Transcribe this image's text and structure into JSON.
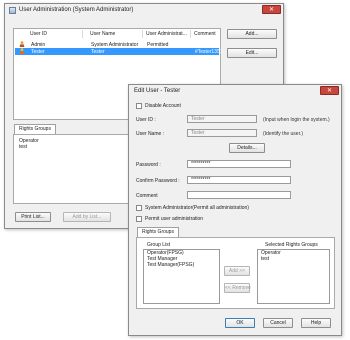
{
  "main_window": {
    "title": "User Administration (System Administrator)",
    "close_glyph": "✕",
    "columns": [
      "User ID",
      "User Name",
      "User Administrat...",
      "Comment"
    ],
    "users": [
      {
        "id": "Admin",
        "name": "System Administrator",
        "admin": "Permitted",
        "comment": ""
      },
      {
        "id": "Tester",
        "name": "Tester",
        "admin": "",
        "comment": "#Tester1351"
      }
    ],
    "add_label": "Add...",
    "edit_label": "Edit...",
    "rights_tab": "Rights Groups",
    "rights_groups": [
      "Operator",
      "test"
    ],
    "print_label": "Print List...",
    "add_by_list_label": "Add by List..."
  },
  "edit_dialog": {
    "title": "Edit User - Tester",
    "close_glyph": "✕",
    "disable_account_label": "Disable Account",
    "user_id_label": "User ID :",
    "user_id_value": "Tester",
    "user_id_hint": "(Input when login the system.)",
    "user_name_label": "User Name :",
    "user_name_value": "Tester",
    "user_name_hint": "(Identify the user.)",
    "details_label": "Details...",
    "password_label": "Password :",
    "password_value": "**********",
    "confirm_label": "Confirm Password :",
    "confirm_value": "**********",
    "comment_label": "Comment",
    "sysadmin_label": "System Administrator(Permit all administration)",
    "permit_label": "Permit user administration",
    "rights_tab": "Rights Groups",
    "group_list_label": "Group List",
    "group_list": [
      "Operator(FPSG)",
      "Test Manager",
      "Test Manager(FPSG)"
    ],
    "selected_label": "Selected Rights Groups",
    "selected_list": [
      "Operator",
      "test"
    ],
    "add_btn": "Add >>",
    "remove_btn": "<< Remove",
    "ok": "OK",
    "cancel": "Cancel",
    "help": "Help"
  },
  "colors": {
    "selection": "#3399ff",
    "close": "#c7473e"
  },
  "icons": [
    "window-icon",
    "user-icon",
    "close-icon",
    "checkbox-icon"
  ]
}
